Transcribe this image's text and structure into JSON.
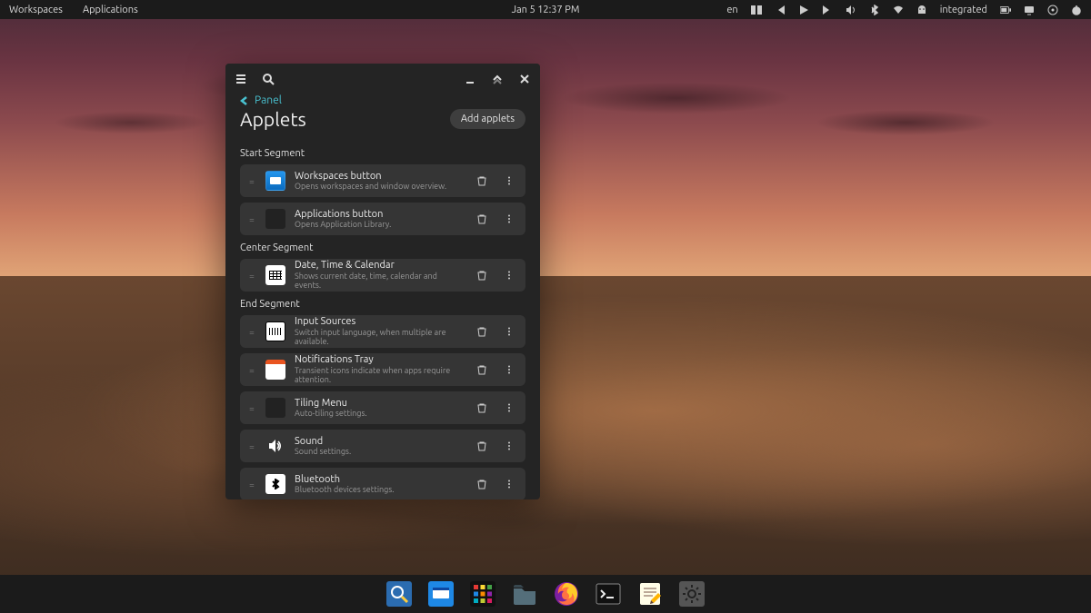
{
  "topbar": {
    "left": [
      "Workspaces",
      "Applications"
    ],
    "center": "Jan 5 12:37 PM",
    "lang": "en",
    "integrated": "integrated"
  },
  "dock": {
    "items": [
      "search",
      "workspaces",
      "apps",
      "files",
      "firefox",
      "terminal",
      "text-editor",
      "settings"
    ]
  },
  "window": {
    "back_label": "Panel",
    "title": "Applets",
    "add_button": "Add applets",
    "segments": [
      {
        "label": "Start Segment",
        "items": [
          {
            "icon": "workspaces",
            "title": "Workspaces button",
            "desc": "Opens workspaces and window overview."
          },
          {
            "icon": "apps",
            "title": "Applications button",
            "desc": "Opens Application Library."
          }
        ]
      },
      {
        "label": "Center Segment",
        "items": [
          {
            "icon": "calendar",
            "title": "Date, Time & Calendar",
            "desc": "Shows current date, time, calendar and events."
          }
        ]
      },
      {
        "label": "End Segment",
        "items": [
          {
            "icon": "keyboard",
            "title": "Input Sources",
            "desc": "Switch input language, when multiple are available."
          },
          {
            "icon": "notifications",
            "title": "Notifications Tray",
            "desc": "Transient icons indicate when apps require attention."
          },
          {
            "icon": "tiling",
            "title": "Tiling Menu",
            "desc": "Auto-tiling settings."
          },
          {
            "icon": "sound",
            "title": "Sound",
            "desc": "Sound settings."
          },
          {
            "icon": "bluetooth",
            "title": "Bluetooth",
            "desc": "Bluetooth devices settings."
          }
        ]
      }
    ]
  }
}
